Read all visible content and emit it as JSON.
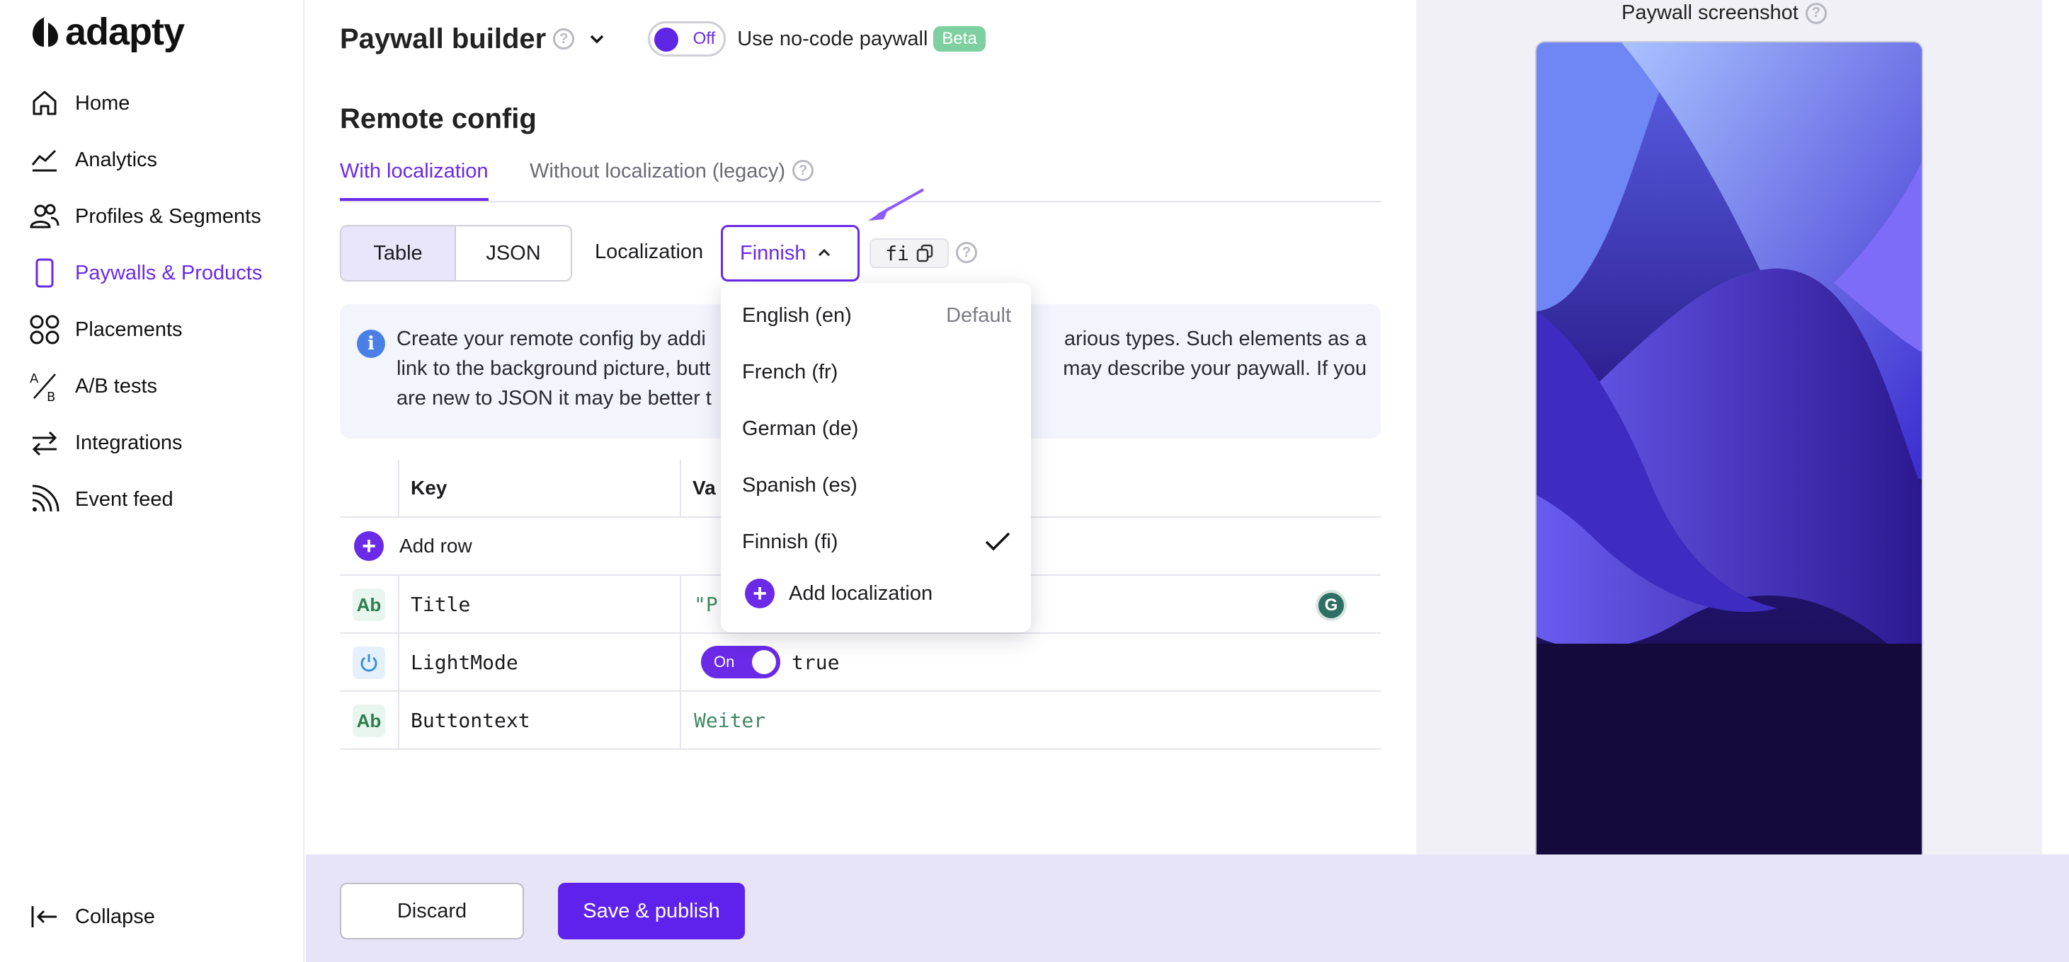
{
  "app": {
    "logo_text": "adapty"
  },
  "sidebar": {
    "items": [
      {
        "label": "Home"
      },
      {
        "label": "Analytics"
      },
      {
        "label": "Profiles & Segments"
      },
      {
        "label": "Paywalls & Products"
      },
      {
        "label": "Placements"
      },
      {
        "label": "A/B tests"
      },
      {
        "label": "Integrations"
      },
      {
        "label": "Event feed"
      }
    ],
    "collapse_label": "Collapse",
    "active": "Paywalls & Products"
  },
  "header": {
    "title": "Paywall builder",
    "nocode_toggle": {
      "state": "Off"
    },
    "nocode_label": "Use no-code paywall",
    "beta_badge": "Beta"
  },
  "section": {
    "title": "Remote config",
    "tabs": [
      {
        "label": "With localization",
        "active": true
      },
      {
        "label": "Without localization (legacy)",
        "active": false
      }
    ]
  },
  "view_switch": {
    "options": [
      "Table",
      "JSON"
    ],
    "selected": "Table"
  },
  "localization": {
    "label": "Localization",
    "selected": "Finnish",
    "code": "fi",
    "options": [
      {
        "label": "English (en)",
        "note": "Default"
      },
      {
        "label": "French (fr)",
        "note": ""
      },
      {
        "label": "German (de)",
        "note": ""
      },
      {
        "label": "Spanish (es)",
        "note": ""
      },
      {
        "label": "Finnish (fi)",
        "note": "",
        "checked": true
      }
    ],
    "add_label": "Add localization"
  },
  "info": {
    "line1": "Create your remote config by addi",
    "line1_end": "arious types. Such elements as a",
    "line2": "link to the background picture, butt",
    "line2_end": "may describe your paywall. If you",
    "line3": "are new to JSON it may be better t"
  },
  "table": {
    "columns": [
      "Key",
      "Va"
    ],
    "add_row_label": "Add row",
    "rows": [
      {
        "type": "Ab",
        "key": "Title",
        "value": "\"P"
      },
      {
        "type": "bool",
        "key": "LightMode",
        "toggle": "On",
        "value": "true"
      },
      {
        "type": "Ab",
        "key": "Buttontext",
        "value": "Weiter"
      }
    ]
  },
  "footer": {
    "discard_label": "Discard",
    "save_label": "Save & publish"
  },
  "preview": {
    "title": "Paywall screenshot"
  },
  "colors": {
    "accent": "#6a2ae8",
    "bottom_bar": "#e7e4f7",
    "right_panel": "#f0f0f6"
  }
}
